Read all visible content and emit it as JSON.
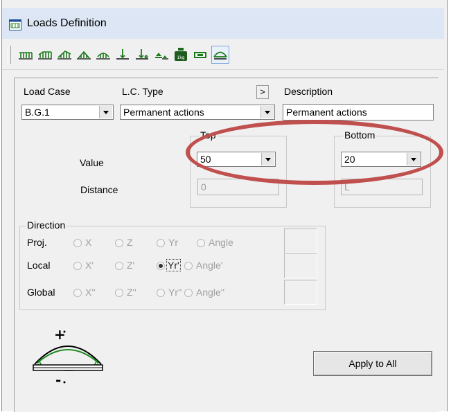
{
  "window": {
    "title": "Loads Definition"
  },
  "toolbar": {
    "buttons": [
      {
        "name": "uniform-load-icon"
      },
      {
        "name": "trapezoidal-load-icon"
      },
      {
        "name": "triangular-load-icon"
      },
      {
        "name": "partial-triangular-load-icon"
      },
      {
        "name": "arc-partial-load-icon"
      },
      {
        "name": "point-load-icon"
      },
      {
        "name": "point-load-offset-icon"
      },
      {
        "name": "moment-load-icon"
      },
      {
        "name": "weight-load-icon",
        "label": "1kg"
      },
      {
        "name": "rectangle-load-icon"
      },
      {
        "name": "parabolic-load-icon"
      }
    ]
  },
  "form": {
    "load_case_label": "Load Case",
    "load_case_value": "B.G.1",
    "lc_type_label": "L.C. Type",
    "lc_type_value": "Permanent actions",
    "more_button": ">",
    "description_label": "Description",
    "description_value": "Permanent actions",
    "top_group": "Top",
    "bottom_group": "Bottom",
    "value_label": "Value",
    "top_value": "50",
    "bottom_value": "20",
    "distance_label": "Distance",
    "top_distance": "0",
    "bottom_distance": "L"
  },
  "direction": {
    "title": "Direction",
    "rows": [
      {
        "label": "Proj.",
        "options": [
          "X",
          "Z",
          "Yr",
          "Angle"
        ],
        "selected": null
      },
      {
        "label": "Local",
        "options": [
          "X'",
          "Z'",
          "Yr'",
          "Angle'"
        ],
        "selected": 2
      },
      {
        "label": "Global",
        "options": [
          "X''",
          "Z''",
          "Yr''",
          "Angle''"
        ],
        "selected": null
      }
    ]
  },
  "diagram": {
    "plus": "+",
    "minus": "-"
  },
  "apply_button": "Apply to All",
  "colors": {
    "highlight": "#c0504d",
    "icon_green": "#1a7a1a",
    "title_bar": "#dce6f4"
  }
}
